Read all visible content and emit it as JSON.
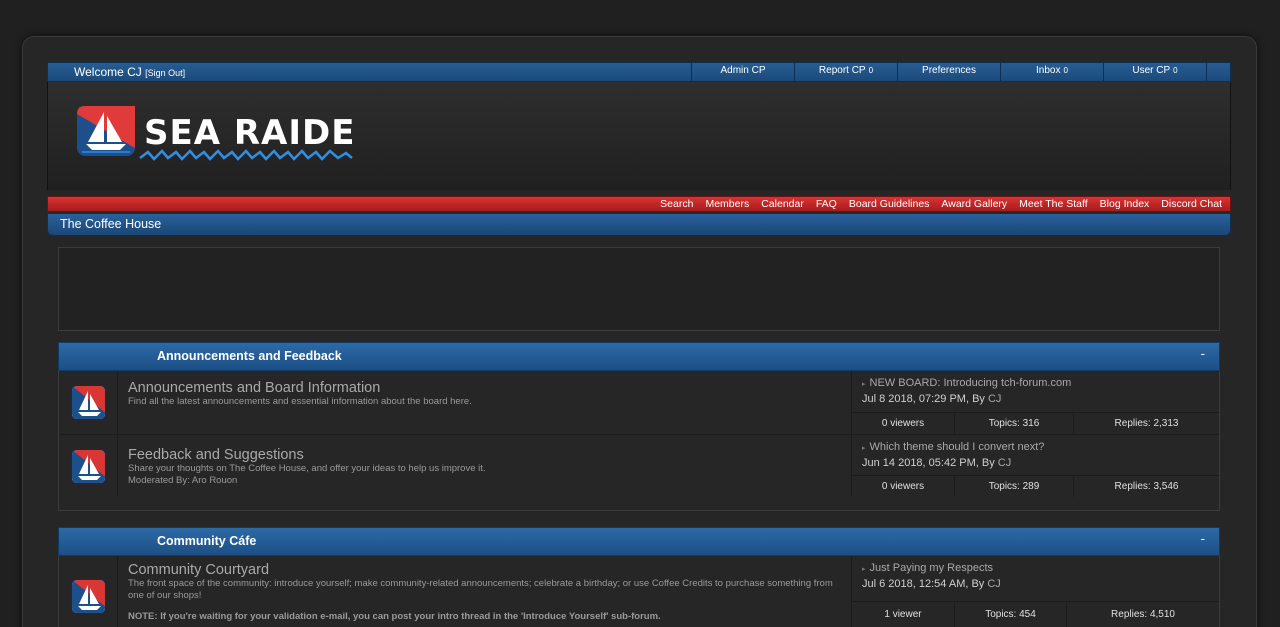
{
  "colors": {
    "accent_blue": "#1f5286",
    "accent_red": "#c62828",
    "background": "#202020"
  },
  "header": {
    "welcome_text": "Welcome CJ",
    "sign_out": "[Sign Out]",
    "links": [
      {
        "label": "Admin CP",
        "count": ""
      },
      {
        "label": "Report CP",
        "count": "0"
      },
      {
        "label": "Preferences",
        "count": ""
      },
      {
        "label": "Inbox",
        "count": "0"
      },
      {
        "label": "User CP",
        "count": "0"
      }
    ]
  },
  "logo": {
    "text": "SEA RAIDERS",
    "icon": "sailboat-icon"
  },
  "nav": {
    "links": [
      "Search",
      "Members",
      "Calendar",
      "FAQ",
      "Board Guidelines",
      "Award Gallery",
      "Meet The Staff",
      "Blog Index",
      "Discord Chat"
    ]
  },
  "breadcrumb": {
    "title": "The Coffee House"
  },
  "categories": [
    {
      "title": "Announcements and Feedback",
      "collapse": "-",
      "forums": [
        {
          "name": "Announcements and Board Information",
          "description": "Find all the latest announcements and essential information about the board here.",
          "moderated": "",
          "note": "",
          "last_title": "NEW BOARD: Introducing tch-forum.com",
          "last_date": "Jul 8 2018, 07:29 PM, By ",
          "last_author": "CJ",
          "viewers": "0 viewers",
          "topics": "Topics: 316",
          "replies": "Replies: 2,313"
        },
        {
          "name": "Feedback and Suggestions",
          "description": "Share your thoughts on The Coffee House, and offer your ideas to help us improve it.",
          "moderated": "Moderated By: Aro Rouon",
          "note": "",
          "last_title": "Which theme should I convert next?",
          "last_date": "Jun 14 2018, 05:42 PM, By ",
          "last_author": "CJ",
          "viewers": "0 viewers",
          "topics": "Topics: 289",
          "replies": "Replies: 3,546"
        }
      ]
    },
    {
      "title": "Community Cáfe",
      "collapse": "-",
      "forums": [
        {
          "name": "Community Courtyard",
          "description": "The front space of the community: introduce yourself; make community-related announcements; celebrate a birthday; or use Coffee Credits to purchase something from one of our shops!",
          "moderated": "",
          "note": "NOTE: If you're waiting for your validation e-mail, you can post your intro thread in the 'Introduce Yourself' sub-forum.",
          "last_title": "Just Paying my Respects",
          "last_date": "Jul 6 2018, 12:54 AM, By ",
          "last_author": "CJ",
          "viewers": "1 viewer",
          "topics": "Topics: 454",
          "replies": "Replies: 4,510"
        }
      ]
    }
  ]
}
